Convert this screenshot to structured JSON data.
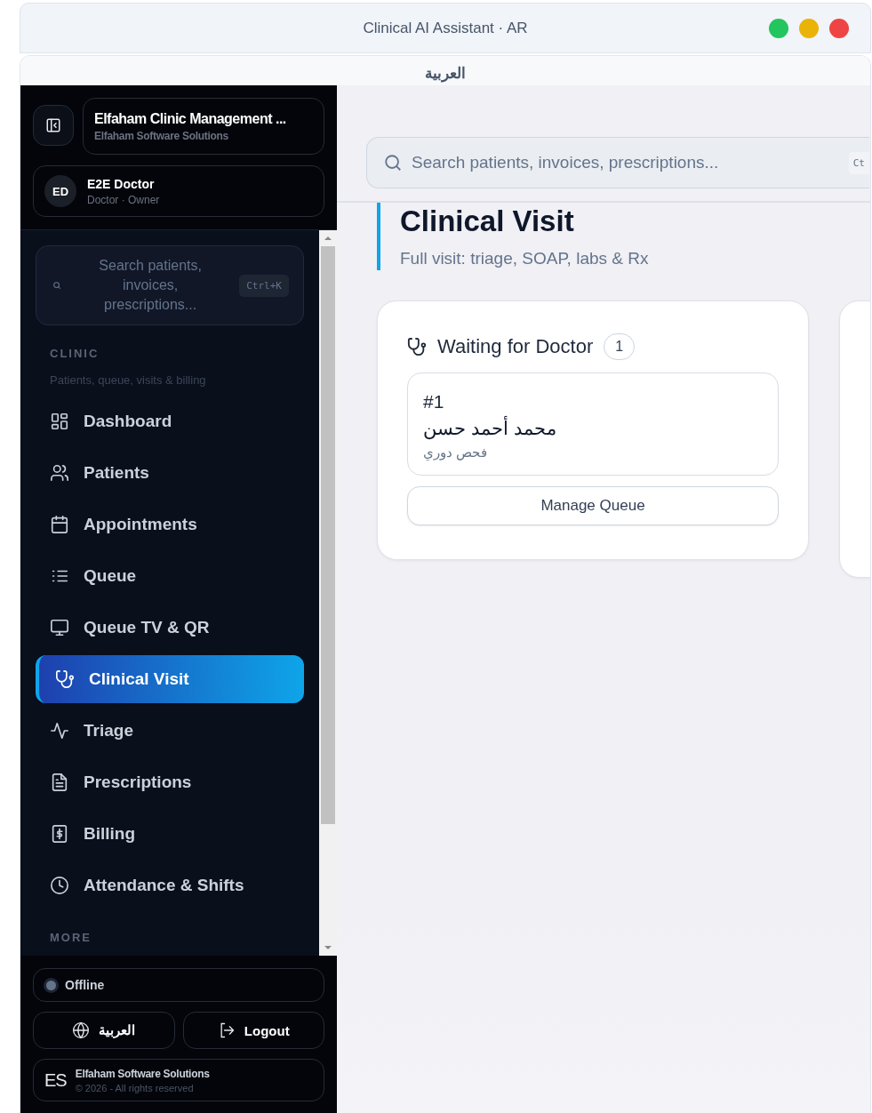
{
  "window": {
    "title": "Clinical AI Assistant · AR"
  },
  "tab": {
    "label": "العربية"
  },
  "sidebar": {
    "brand": {
      "title": "Elfaham Clinic Management ...",
      "subtitle": "Elfaham Software Solutions"
    },
    "user": {
      "initials": "ED",
      "name": "E2E Doctor",
      "role": "Doctor · Owner"
    },
    "search": {
      "placeholder": "Search patients, invoices, prescriptions...",
      "shortcut": "Ctrl+K"
    },
    "sections": [
      {
        "title": "CLINIC",
        "subtitle": "Patients, queue, visits & billing",
        "items": [
          {
            "label": "Dashboard",
            "selected": false
          },
          {
            "label": "Patients",
            "selected": false
          },
          {
            "label": "Appointments",
            "selected": false
          },
          {
            "label": "Queue",
            "selected": false
          },
          {
            "label": "Queue TV & QR",
            "selected": false
          },
          {
            "label": "Clinical Visit",
            "selected": true
          },
          {
            "label": "Triage",
            "selected": false
          },
          {
            "label": "Prescriptions",
            "selected": false
          },
          {
            "label": "Billing",
            "selected": false
          },
          {
            "label": "Attendance & Shifts",
            "selected": false
          }
        ]
      },
      {
        "title": "MORE"
      }
    ],
    "status": {
      "label": "Offline",
      "online": false
    },
    "language_button": "العربية",
    "logout_button": "Logout",
    "footer": {
      "logo": "ES",
      "company": "Elfaham Software Solutions",
      "copyright": "© 2026 - All rights reserved"
    }
  },
  "main": {
    "search": {
      "placeholder": "Search patients, invoices, prescriptions...",
      "shortcut": "Ct"
    },
    "title": "Clinical Visit",
    "subtitle": "Full visit: triage, SOAP, labs & Rx",
    "columns": [
      {
        "title": "Waiting for Doctor",
        "count": "1",
        "patients": [
          {
            "number": "#1",
            "name": "محمد أحمد حسن",
            "reason": "فحص دوري"
          }
        ],
        "action": "Manage Queue"
      }
    ]
  }
}
